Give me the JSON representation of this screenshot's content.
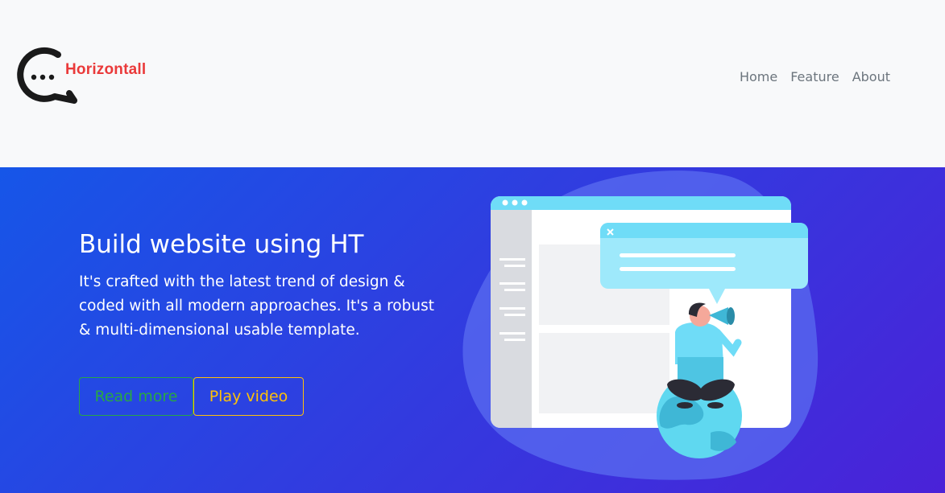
{
  "brand": {
    "name": "Horizontall",
    "logo_icon": "chat-bubble-dots-icon"
  },
  "nav": {
    "links": [
      {
        "label": "Home"
      },
      {
        "label": "Feature"
      },
      {
        "label": "About"
      }
    ]
  },
  "hero": {
    "title": "Build website using HT",
    "description": "It's crafted with the latest trend of design & coded with all modern approaches. It's a robust & multi-dimensional usable template.",
    "buttons": {
      "read_more": "Read more",
      "play_video": "Play video"
    },
    "illustration": "person-with-megaphone-on-globe-browser-illustration"
  },
  "colors": {
    "brand_red": "#ea3a3a",
    "hero_gradient_start": "#1656e8",
    "hero_gradient_end": "#4a22d8",
    "success": "#28a745",
    "warning": "#ffc107",
    "nav_text": "#6c757d"
  }
}
